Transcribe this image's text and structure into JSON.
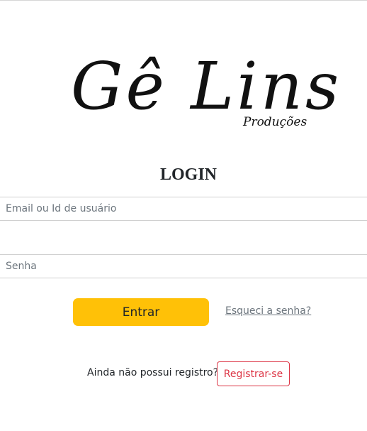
{
  "logo": {
    "main_text": "Gê Lins",
    "sub_text": "Produções"
  },
  "login": {
    "title": "LOGIN",
    "email": {
      "value": "",
      "placeholder": "Email ou Id de usuário"
    },
    "password": {
      "value": "",
      "placeholder": "Senha"
    },
    "submit_label": "Entrar",
    "forgot_label": "Esqueci a senha?"
  },
  "register": {
    "prompt": "Ainda não possui registro?",
    "button_label": "Registrar-se"
  },
  "colors": {
    "primary_button": "#ffc107",
    "register_outline": "#dc3545",
    "link": "#6c757d"
  }
}
